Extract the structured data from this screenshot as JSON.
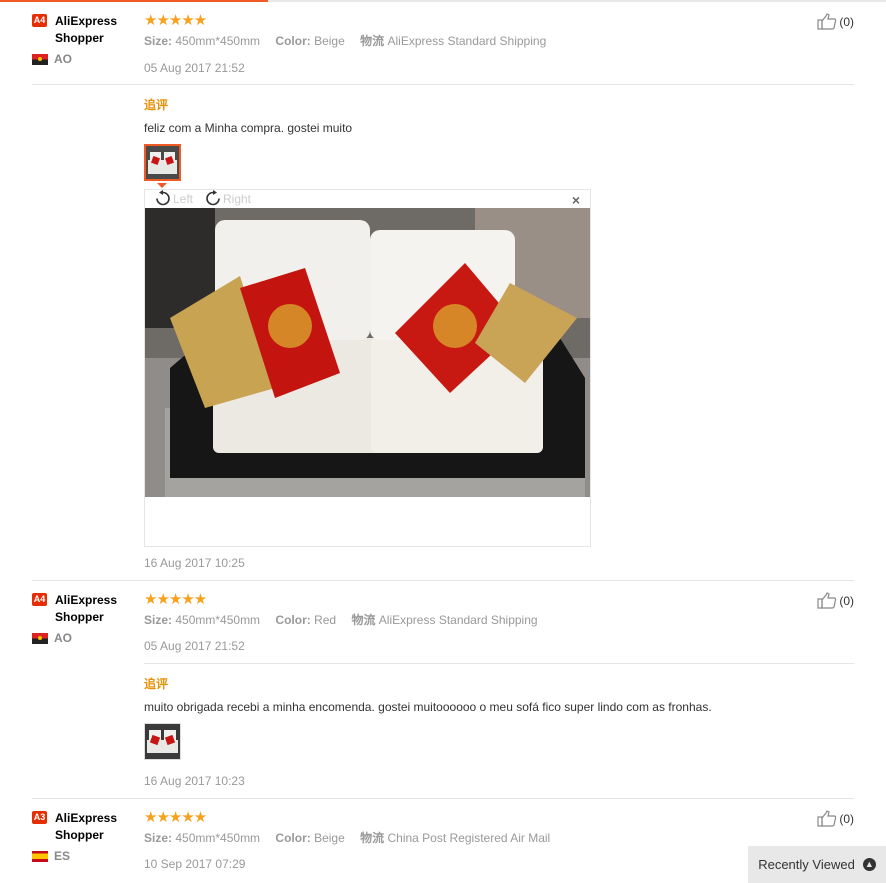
{
  "reviews": [
    {
      "badge": "A4",
      "user": "AliExpress Shopper",
      "country": "AO",
      "stars": "★★★★★",
      "size_label": "Size:",
      "size": "450mm*450mm",
      "color_label": "Color:",
      "color": "Beige",
      "ship_label": "物流",
      "ship": "AliExpress Standard Shipping",
      "date": "05 Aug 2017 21:52",
      "likes": "(0)",
      "followup_title": "追评",
      "followup_text": "feliz com a Minha compra. gostei muito",
      "followup_date": "16 Aug 2017 10:25"
    },
    {
      "badge": "A4",
      "user": "AliExpress Shopper",
      "country": "AO",
      "stars": "★★★★★",
      "size_label": "Size:",
      "size": "450mm*450mm",
      "color_label": "Color:",
      "color": "Red",
      "ship_label": "物流",
      "ship": "AliExpress Standard Shipping",
      "date": "05 Aug 2017 21:52",
      "likes": "(0)",
      "followup_title": "追评",
      "followup_text": "muito obrigada recebi a minha encomenda. gostei muitoooooo o meu sofá fico super lindo com as fronhas.",
      "followup_date": "16 Aug 2017 10:23"
    },
    {
      "badge": "A3",
      "user": "AliExpress Shopper",
      "country": "ES",
      "stars": "★★★★★",
      "size_label": "Size:",
      "size": "450mm*450mm",
      "color_label": "Color:",
      "color": "Beige",
      "ship_label": "物流",
      "ship": "China Post Registered Air Mail",
      "date": "10 Sep 2017 07:29",
      "likes": "(0)"
    }
  ],
  "viewer": {
    "rotate_left": "Left",
    "rotate_right": "Right",
    "close": "×"
  },
  "recently_viewed": "Recently Viewed"
}
